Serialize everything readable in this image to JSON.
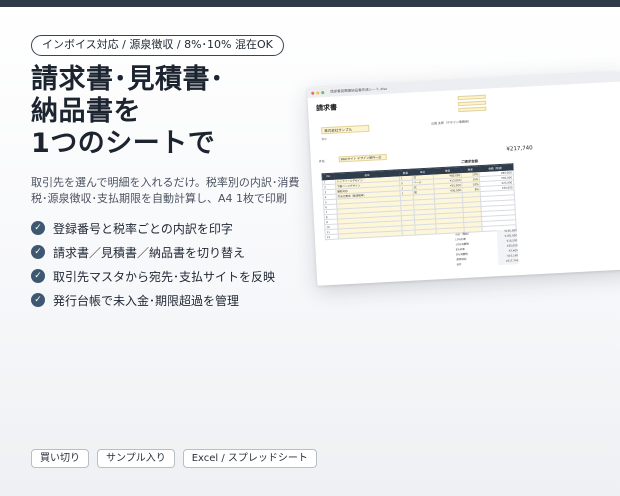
{
  "tag_line": "インボイス対応 / 源泉徴収 / 8%･10% 混在OK",
  "headline": [
    "請求書･見積書･",
    "納品書を",
    "1つのシートで"
  ],
  "description": "取引先を選んで明細を入れるだけ。税率別の内訳･消費税･源泉徴収･支払期限を自動計算し、A4 1枚で印刷",
  "features": [
    "登録番号と税率ごとの内訳を印字",
    "請求書／見積書／納品書を切り替え",
    "取引先マスタから宛先･支払サイトを反映",
    "発行台帳で未入金･期限超過を管理"
  ],
  "bottom_tags": [
    "買い切り",
    "サンプル入り",
    "Excel / スプレッドシート"
  ],
  "colors": {
    "accent": "#3f5871",
    "topbar": "#2f3a48",
    "highlight": "#fdf3cf"
  },
  "icons": {
    "feature_bullet": "check-circle-icon"
  },
  "sheet": {
    "file_name": "請求書見積書納品書作成シート.xlsx",
    "title": "請求書",
    "client": "株式会社サンプル",
    "honorific": "御中",
    "sender_name": "山田 太郎（デザイン事務所）",
    "subject_label": "件名",
    "subject": "Webサイト デザイン制作一式",
    "amount_title": "ご請求金額",
    "amount": "¥217,740",
    "columns": [
      "No.",
      "品名",
      "数量",
      "単位",
      "単価",
      "税率",
      "金額（税抜）"
    ],
    "rows": [
      [
        "1",
        "トップページデザイン",
        "1",
        "式",
        "¥80,000",
        "10%",
        "¥80,000"
      ],
      [
        "2",
        "下層ページデザイン",
        "5",
        "ページ",
        "¥12,000",
        "10%",
        "¥60,000"
      ],
      [
        "3",
        "撮影対応",
        "1",
        "式",
        "¥25,000",
        "10%",
        "¥25,000"
      ],
      [
        "4",
        "打合せ費用（軽減税率）",
        "1",
        "回",
        "¥30,000",
        "8%",
        "¥30,000"
      ],
      [
        "5",
        "",
        "",
        "",
        "",
        "",
        ""
      ],
      [
        "6",
        "",
        "",
        "",
        "",
        "",
        ""
      ],
      [
        "7",
        "",
        "",
        "",
        "",
        "",
        ""
      ],
      [
        "8",
        "",
        "",
        "",
        "",
        "",
        ""
      ],
      [
        "9",
        "",
        "",
        "",
        "",
        "",
        ""
      ],
      [
        "10",
        "",
        "",
        "",
        "",
        "",
        ""
      ],
      [
        "11",
        "",
        "",
        "",
        "",
        "",
        ""
      ],
      [
        "12",
        "",
        "",
        "",
        "",
        "",
        ""
      ]
    ],
    "totals": [
      [
        "小計（税抜）",
        "¥195,000"
      ],
      [
        "10%対象",
        "¥165,000"
      ],
      [
        "10%消費税",
        "¥16,500"
      ],
      [
        "8%対象",
        "¥30,000"
      ],
      [
        "8%消費税",
        "¥2,400"
      ],
      [
        "源泉徴収",
        "-¥16,160"
      ],
      [
        "合計",
        "¥217,740"
      ]
    ]
  }
}
